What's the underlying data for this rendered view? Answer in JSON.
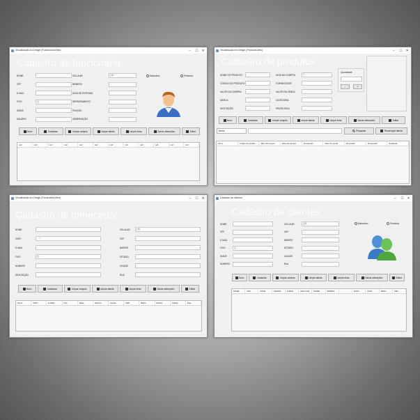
{
  "windows": {
    "funcionario": {
      "title": "Visualização do Design (FuncionarioView)",
      "heading": "Cadastro de funcionário",
      "left_labels": [
        "NOME",
        "CPF",
        "E-MAIL",
        "FIXO",
        "IDADE",
        "SALÁRIO"
      ],
      "left_values": [
        "",
        " .  .  -",
        "",
        "( )   -",
        "",
        ""
      ],
      "mid_labels": [
        "CELULAR",
        "NÚMERO",
        "DATA DE ENTRADA",
        "DEPARTAMENTO",
        "FUNÇÃO",
        "OBSERVAÇÃO"
      ],
      "mid_values": [
        "( )9   -",
        "",
        "",
        "",
        "",
        ""
      ],
      "radio_1": "Masculino",
      "radio_2": "Feminino",
      "buttons": [
        "Novo",
        "Cadastrar",
        "Limpar campos",
        "Limpar tabela",
        "Limpar linha",
        "Salvar alterações",
        "Editar"
      ],
      "grid_cols": [
        "null",
        "null",
        "null",
        "null",
        "null",
        "null",
        "null",
        "null",
        "null",
        "null",
        "null",
        "null"
      ]
    },
    "produtos": {
      "title": "Visualização do Design (ProdutosView)",
      "heading": "Cadastro de produtos",
      "left_labels": [
        "NOME DO PRODUTO",
        "CÓDIGO DO PRODUTO",
        "VALOR DA COMPRA",
        "MARCA",
        "DESCRIÇÃO"
      ],
      "mid_labels": [
        "DATA DA COMPRA",
        "FORNECEDOR",
        "VALOR DA VENDA",
        "CATEGORIA",
        "PRATELEIRA"
      ],
      "mid_values": [
        "/  /",
        "",
        "",
        "",
        ""
      ],
      "qty_label": "Quantidade",
      "qty_minus": "-",
      "qty_plus": "+",
      "buttons": [
        "Novo",
        "Cadastrar",
        "Limpar campos",
        "Limpar tabela",
        "Limpar linha",
        "Salvar alterações",
        "Editar"
      ],
      "search_select": "Nome",
      "search_button": "Pesquisar",
      "reload_button": "Recarregar tabela",
      "grid_cols": [
        "Nome",
        "Código do produto",
        "Valor da compra",
        "Data da compra",
        "Fornecedor",
        "Valor da venda",
        "Descrição",
        "Fornecedor",
        "Prateleira"
      ]
    },
    "fornecedor": {
      "title": "Visualização do Design (FornecedorView)",
      "heading": "Cadastro de fornecedor",
      "left_labels": [
        "NOME",
        "CNPJ",
        "E-MAIL",
        "FIXO",
        "NÚMERO",
        "DESCRIÇÃO"
      ],
      "left_values": [
        "",
        " .  .  /  -",
        "",
        "( )   -",
        "",
        ""
      ],
      "mid_labels": [
        "CELULAR",
        "CEP",
        "BAIRRO",
        "ESTADO",
        "CIDADE",
        "RUA"
      ],
      "mid_values": [
        "( )9   -",
        "   -",
        "",
        "",
        "",
        ""
      ],
      "buttons": [
        "Novo",
        "Cadastrar",
        "Limpar campos",
        "Limpar tabela",
        "Limpar linha",
        "Salvar alterações",
        "Editar"
      ],
      "grid_cols": [
        "Nome",
        "CNPJ",
        "E-MAIL",
        "Fixo",
        "Idade",
        "Número",
        "Celular",
        "CEP",
        "Bairro",
        "Estado",
        "Cidade",
        "Rua"
      ]
    },
    "clientes": {
      "title": "Cadastro de clientes",
      "heading": "Cadastro de clientes",
      "left_labels": [
        "NOME",
        "CPF",
        "E-MAIL",
        "FIXO",
        "IDADE",
        "NÚMERO"
      ],
      "left_values": [
        "",
        " .  .  -",
        "",
        "( )   -",
        "",
        ""
      ],
      "mid_labels": [
        "CELULAR",
        "CEP",
        "BAIRRO",
        "ESTADO",
        "CIDADE",
        "Rua"
      ],
      "mid_values": [
        "( )9   -",
        "   -",
        "",
        "",
        "",
        ""
      ],
      "radio_1": "Masculino",
      "radio_2": "Feminino",
      "buttons": [
        "Novo",
        "Cadastrar",
        "Limpar campos",
        "Limpar tabela",
        "Limpar linha",
        "Salvar alterações",
        "Editar"
      ],
      "grid_cols": [
        "NOME",
        "CPF",
        "FONE",
        "CIDADE",
        "E-MAIL",
        "CELULAR",
        "IDADE",
        "BAIRRO",
        "",
        "ESTA...",
        "NÚM...",
        "SEXO",
        "CEP"
      ]
    }
  },
  "colors": {
    "heading": "#ffffff",
    "window_bg": "#f0f0f0",
    "button_bg": "#e5e5e5"
  }
}
